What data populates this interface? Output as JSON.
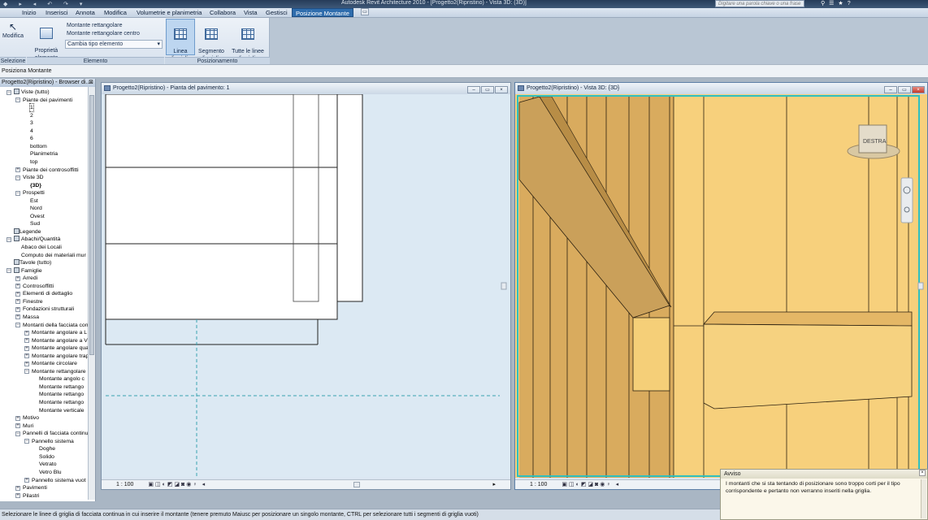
{
  "titlebar": {
    "app_title": "Autodesk Revit Architecture 2010 - [Progetto2(Ripristino) - Vista 3D: (3D)]",
    "search_placeholder": "Digitare una parola chiave o una frase"
  },
  "menu": {
    "tabs": [
      "Inizio",
      "Inserisci",
      "Annota",
      "Modifica",
      "Volumetrie e planimetria",
      "Collabora",
      "Vista",
      "Gestisci",
      "Posizione Montante"
    ]
  },
  "ribbon": {
    "modify_label": "Modifica",
    "element_props_label": "Proprietà\nelemento",
    "type_items": [
      "Montante rettangolare",
      "Montante rettangolare centro"
    ],
    "change_type_label": "Cambia tipo elemento",
    "grid_line_label": "Linea\ndi griglia",
    "grid_segment_label": "Segmento\ndi griglia",
    "all_grid_lines_label": "Tutte le linee\ndi griglia",
    "panels": [
      "Selezione",
      "Elemento",
      "Posizionamento"
    ]
  },
  "context_bar": "Posiziona Montante",
  "browser": {
    "title": "Progetto2(Ripristino) - Browser di...",
    "tree": [
      {
        "label": "Viste (tutto)",
        "level": 0,
        "toggle": "-",
        "icon": true
      },
      {
        "label": "Piante dei pavimenti",
        "level": 1,
        "toggle": "-"
      },
      {
        "label": "1",
        "level": 2,
        "selected": true
      },
      {
        "label": "2",
        "level": 2
      },
      {
        "label": "3",
        "level": 2
      },
      {
        "label": "4",
        "level": 2
      },
      {
        "label": "6",
        "level": 2
      },
      {
        "label": "bottom",
        "level": 2
      },
      {
        "label": "Planimetria",
        "level": 2
      },
      {
        "label": "top",
        "level": 2
      },
      {
        "label": "Piante dei controsoffitti",
        "level": 1,
        "toggle": "+"
      },
      {
        "label": "Viste 3D",
        "level": 1,
        "toggle": "-"
      },
      {
        "label": "{3D}",
        "level": 2,
        "bold": true
      },
      {
        "label": "Prospetti",
        "level": 1,
        "toggle": "-"
      },
      {
        "label": "Est",
        "level": 2
      },
      {
        "label": "Nord",
        "level": 2
      },
      {
        "label": "Ovest",
        "level": 2
      },
      {
        "label": "Sud",
        "level": 2
      },
      {
        "label": "Legende",
        "level": 0,
        "icon": true
      },
      {
        "label": "Abachi/Quantità",
        "level": 0,
        "toggle": "-",
        "icon": true
      },
      {
        "label": "Abaco dei Locali",
        "level": 1
      },
      {
        "label": "Computo dei materiali mur",
        "level": 1
      },
      {
        "label": "Tavole (tutto)",
        "level": 0,
        "icon": true
      },
      {
        "label": "Famiglie",
        "level": 0,
        "toggle": "-",
        "icon": true
      },
      {
        "label": "Arredi",
        "level": 1,
        "toggle": "+"
      },
      {
        "label": "Controsoffitti",
        "level": 1,
        "toggle": "+"
      },
      {
        "label": "Elementi di dettaglio",
        "level": 1,
        "toggle": "+"
      },
      {
        "label": "Finestre",
        "level": 1,
        "toggle": "+"
      },
      {
        "label": "Fondazioni strutturali",
        "level": 1,
        "toggle": "+"
      },
      {
        "label": "Massa",
        "level": 1,
        "toggle": "+"
      },
      {
        "label": "Montanti della facciata con",
        "level": 1,
        "toggle": "-"
      },
      {
        "label": "Montante angolare a L",
        "level": 2,
        "toggle": "+"
      },
      {
        "label": "Montante angolare a V",
        "level": 2,
        "toggle": "+"
      },
      {
        "label": "Montante angolare qua",
        "level": 2,
        "toggle": "+"
      },
      {
        "label": "Montante angolare trap",
        "level": 2,
        "toggle": "+"
      },
      {
        "label": "Montante circolare",
        "level": 2,
        "toggle": "+"
      },
      {
        "label": "Montante rettangolare",
        "level": 2,
        "toggle": "-"
      },
      {
        "label": "Montante angolo c",
        "level": 3
      },
      {
        "label": "Montante rettango",
        "level": 3
      },
      {
        "label": "Montante rettango",
        "level": 3
      },
      {
        "label": "Montante rettango",
        "level": 3
      },
      {
        "label": "Montante verticale",
        "level": 3
      },
      {
        "label": "Motivo",
        "level": 1,
        "toggle": "+"
      },
      {
        "label": "Muri",
        "level": 1,
        "toggle": "+"
      },
      {
        "label": "Pannelli di facciata continu",
        "level": 1,
        "toggle": "-"
      },
      {
        "label": "Pannello sistema",
        "level": 2,
        "toggle": "-"
      },
      {
        "label": "Doghe",
        "level": 3
      },
      {
        "label": "Solido",
        "level": 3
      },
      {
        "label": "Vetrato",
        "level": 3
      },
      {
        "label": "Vetro Blu",
        "level": 3
      },
      {
        "label": "Pannello sistema vuot",
        "level": 2,
        "toggle": "+"
      },
      {
        "label": "Pavimenti",
        "level": 1,
        "toggle": "+"
      },
      {
        "label": "Pilastri",
        "level": 1,
        "toggle": "+"
      }
    ]
  },
  "plan_window": {
    "title": "Progetto2(Ripristino) - Pianta del pavimento: 1",
    "scale": "1 : 100"
  },
  "view3d_window": {
    "title": "Progetto2(Ripristino) - Vista 3D: {3D}",
    "scale": "1 : 100",
    "viewcube_label": "DESTRA"
  },
  "warning": {
    "title": "Avviso",
    "message": "I montanti che si sta tentando di posizionare sono troppo corti per il tipo corrispondente e pertanto non verranno inseriti nella griglia."
  },
  "statusbar": "Selezionare le linee di griglia di facciata continua in cui inserire il montante (tenere premuto Maiusc per posizionare un singolo montante, CTRL per selezionare tutti i segmenti di griglia vuoti)"
}
